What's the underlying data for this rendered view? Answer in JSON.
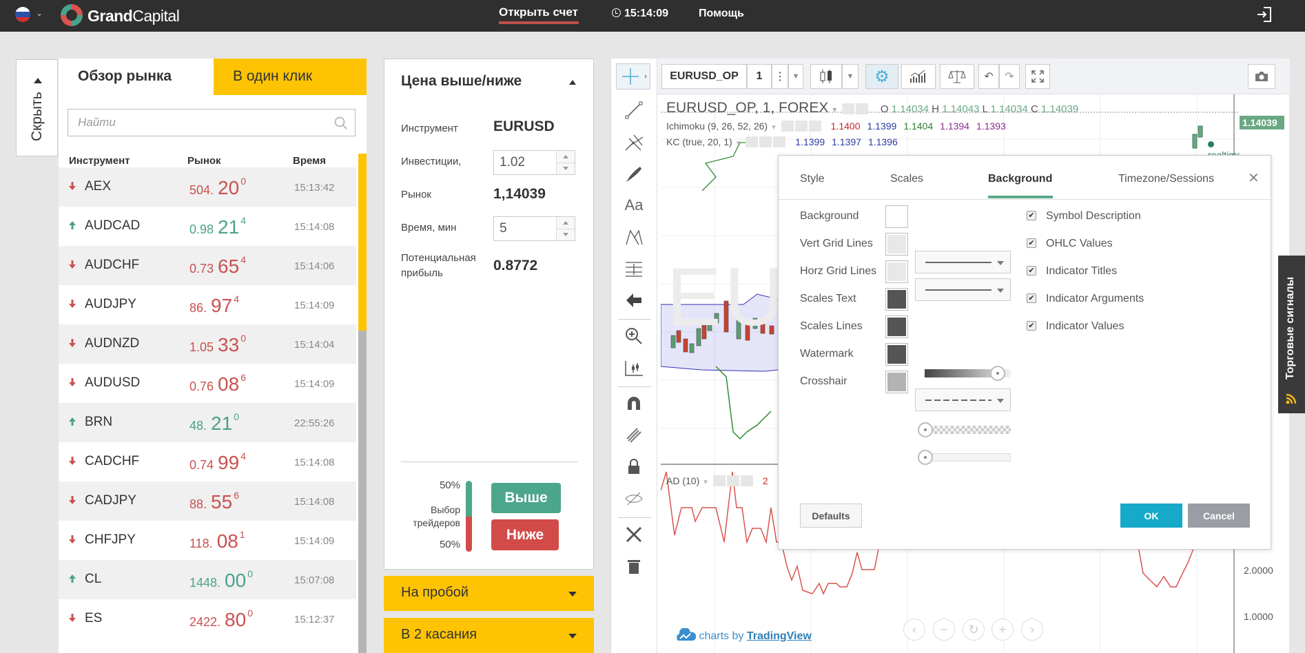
{
  "topbar": {
    "brand_bold": "Grand",
    "brand_light": "Capital",
    "open_account": "Открыть счет",
    "time": "15:14:09",
    "help": "Помощь",
    "colors": {
      "accent_red": "#c0504d",
      "bar_bg": "#2f2f2f"
    }
  },
  "sidebar": {
    "hide_label": "Скрыть"
  },
  "market": {
    "tabs": [
      {
        "label": "Обзор рынка",
        "active": true
      },
      {
        "label": "В один клик",
        "active": false
      }
    ],
    "search_placeholder": "Найти",
    "columns": [
      "Инструмент",
      "Рынок",
      "Время"
    ],
    "rows": [
      {
        "symbol": "AEX",
        "direction": "down",
        "price_a": "504.",
        "price_b": "20",
        "price_c": "0",
        "time": "15:13:42"
      },
      {
        "symbol": "AUDCAD",
        "direction": "up",
        "price_a": "0.98",
        "price_b": "21",
        "price_c": "4",
        "time": "15:14:08"
      },
      {
        "symbol": "AUDCHF",
        "direction": "down",
        "price_a": "0.73",
        "price_b": "65",
        "price_c": "4",
        "time": "15:14:06"
      },
      {
        "symbol": "AUDJPY",
        "direction": "down",
        "price_a": "86.",
        "price_b": "97",
        "price_c": "4",
        "time": "15:14:09"
      },
      {
        "symbol": "AUDNZD",
        "direction": "down",
        "price_a": "1.05",
        "price_b": "33",
        "price_c": "0",
        "time": "15:14:04"
      },
      {
        "symbol": "AUDUSD",
        "direction": "down",
        "price_a": "0.76",
        "price_b": "08",
        "price_c": "6",
        "time": "15:14:09"
      },
      {
        "symbol": "BRN",
        "direction": "up",
        "price_a": "48.",
        "price_b": "21",
        "price_c": "0",
        "time": "22:55:26"
      },
      {
        "symbol": "CADCHF",
        "direction": "down",
        "price_a": "0.74",
        "price_b": "99",
        "price_c": "4",
        "time": "15:14:08"
      },
      {
        "symbol": "CADJPY",
        "direction": "down",
        "price_a": "88.",
        "price_b": "55",
        "price_c": "6",
        "time": "15:14:08"
      },
      {
        "symbol": "CHFJPY",
        "direction": "down",
        "price_a": "118.",
        "price_b": "08",
        "price_c": "1",
        "time": "15:14:09"
      },
      {
        "symbol": "CL",
        "direction": "up",
        "price_a": "1448.",
        "price_b": "00",
        "price_c": "0",
        "time": "15:07:08"
      },
      {
        "symbol": "ES",
        "direction": "down",
        "price_a": "2422.",
        "price_b": "80",
        "price_c": "0",
        "time": "15:12:37"
      }
    ],
    "colors": {
      "down": "#c9514f",
      "up": "#4aa28a",
      "tab_yellow": "#fec404"
    }
  },
  "trade": {
    "title": "Цена выше/ниже",
    "instrument_label": "Инструмент",
    "instrument_value": "EURUSD",
    "investment_label": "Инвестиции,",
    "investment_value": "1.02",
    "market_label": "Рынок",
    "market_value": "1,14039",
    "time_label": "Время, мин",
    "time_value": "5",
    "profit_label_1": "Потенциальная",
    "profit_label_2": "прибыль",
    "profit_value": "0.8772",
    "traders_choice_label_1": "Выбор",
    "traders_choice_label_2": "трейдеров",
    "up_percent": "50%",
    "down_percent": "50%",
    "up_share": 0.5,
    "up_button": "Выше",
    "down_button": "Ниже",
    "accordions": [
      "На пробой",
      "В 2 касания"
    ]
  },
  "chart": {
    "symbol": "EURUSD_OP",
    "interval": "1",
    "legend_title": "EURUSD_OP, 1, FOREX",
    "ohlc": {
      "o_label": "O",
      "o": "1.14034",
      "h_label": "H",
      "h": "1.14043",
      "l_label": "L",
      "l": "1.14034",
      "c_label": "C",
      "c": "1.14039"
    },
    "ichimoku": {
      "name": "Ichimoku (9, 26, 52, 26)",
      "values": [
        "1.1400",
        "1.1399",
        "1.1404",
        "1.1394",
        "1.1393"
      ],
      "colors": [
        "#c62828",
        "#2b3a9e",
        "#2e7d32",
        "#8e2b8e",
        "#8e2b8e"
      ]
    },
    "kc": {
      "name": "KC (true, 20, 1)",
      "values": [
        "1.1399",
        "1.1397",
        "1.1396"
      ],
      "color": "#2b3a9e"
    },
    "ad": {
      "name": "AD (10)",
      "value_partial": "2"
    },
    "realtime_label": "realtime",
    "last_price": "1.14039",
    "watermark": "EUR",
    "ad_axis": [
      "2.0000",
      "1.0000"
    ],
    "credit_prefix": "charts by",
    "credit_link": "TradingView"
  },
  "dialog": {
    "tabs": [
      "Style",
      "Scales",
      "Background",
      "Timezone/Sessions"
    ],
    "active_tab": "Background",
    "rows": [
      {
        "label": "Background",
        "color": "#ffffff"
      },
      {
        "label": "Vert Grid Lines",
        "color": "#e8e8e8"
      },
      {
        "label": "Horz Grid Lines",
        "color": "#e8e8e8"
      },
      {
        "label": "Scales Text",
        "color": "#555555"
      },
      {
        "label": "Scales Lines",
        "color": "#555555"
      },
      {
        "label": "Watermark",
        "color": "#555555"
      },
      {
        "label": "Crosshair",
        "color": "#b3b3b3"
      }
    ],
    "checkboxes": [
      {
        "label": "Symbol Description",
        "checked": true
      },
      {
        "label": "OHLC Values",
        "checked": true
      },
      {
        "label": "Indicator Titles",
        "checked": true
      },
      {
        "label": "Indicator Arguments",
        "checked": true
      },
      {
        "label": "Indicator Values",
        "checked": true
      }
    ],
    "watermark_opacity": 0.85,
    "crosshair_opacity": 0.0,
    "crosshair_width": 0.0,
    "defaults_button": "Defaults",
    "ok_button": "OK",
    "cancel_button": "Cancel",
    "ok_color": "#17a9c9"
  },
  "signals": {
    "label": "Торговые сигналы"
  }
}
